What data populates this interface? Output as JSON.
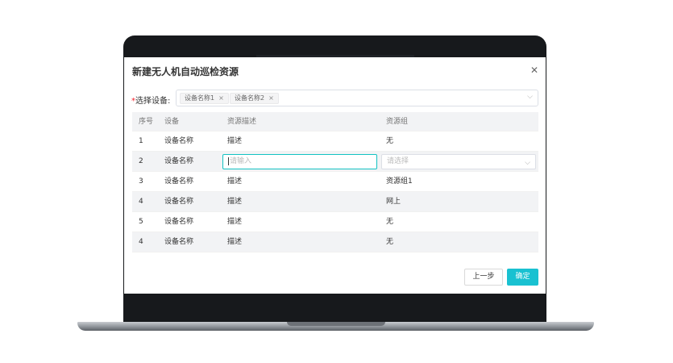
{
  "dialog": {
    "title": "新建无人机自动巡检资源",
    "close_icon": "close-icon"
  },
  "device_select": {
    "required_mark": "*",
    "label": "选择设备:",
    "tags": [
      {
        "label": "设备名称1"
      },
      {
        "label": "设备名称2"
      }
    ],
    "remove_glyph": "×"
  },
  "table": {
    "headers": [
      "序号",
      "设备",
      "资源描述",
      "资源组"
    ],
    "rows": [
      {
        "index": "1",
        "device": "设备名称",
        "desc": "描述",
        "group": "无"
      },
      {
        "index": "2",
        "device": "设备名称",
        "desc_placeholder": "请输入",
        "group_placeholder": "请选择"
      },
      {
        "index": "3",
        "device": "设备名称",
        "desc": "描述",
        "group": "资源组1"
      },
      {
        "index": "4",
        "device": "设备名称",
        "desc": "描述",
        "group": "网上"
      },
      {
        "index": "5",
        "device": "设备名称",
        "desc": "描述",
        "group": "无"
      },
      {
        "index": "4",
        "device": "设备名称",
        "desc": "描述",
        "group": "无"
      }
    ]
  },
  "footer": {
    "prev_label": "上一步",
    "ok_label": "确定"
  },
  "colors": {
    "accent": "#19c1d1",
    "header_bg": "#f2f3f5",
    "required": "#f5222d"
  }
}
